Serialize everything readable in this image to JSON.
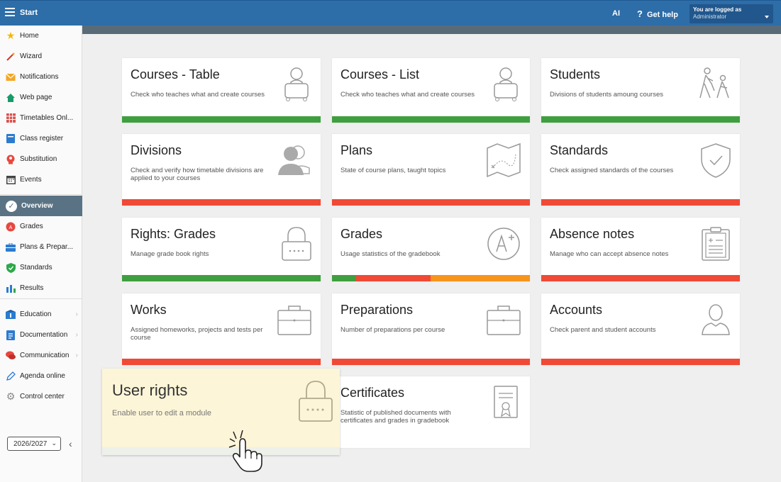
{
  "topbar": {
    "title": "Start",
    "ai_label": "AI",
    "help_label": "Get help",
    "help_icon": "?",
    "logged_line1": "You are logged as",
    "logged_line2": "Administrator"
  },
  "sidebar": {
    "items": [
      {
        "label": "Home",
        "icon": "star-icon"
      },
      {
        "label": "Wizard",
        "icon": "wand-icon"
      },
      {
        "label": "Notifications",
        "icon": "envelope-icon"
      },
      {
        "label": "Web page",
        "icon": "house-icon"
      },
      {
        "label": "Timetables Onl...",
        "icon": "timetable-icon"
      },
      {
        "label": "Class register",
        "icon": "register-icon"
      },
      {
        "label": "Substitution",
        "icon": "substitution-icon"
      },
      {
        "label": "Events",
        "icon": "calendar-icon"
      },
      {
        "label": "Overview",
        "icon": "check-circle-icon"
      },
      {
        "label": "Grades",
        "icon": "grades-icon"
      },
      {
        "label": "Plans & Prepar...",
        "icon": "briefcase-icon"
      },
      {
        "label": "Standards",
        "icon": "shield-icon"
      },
      {
        "label": "Results",
        "icon": "bar-chart-icon"
      },
      {
        "label": "Education",
        "icon": "education-icon"
      },
      {
        "label": "Documentation",
        "icon": "document-icon"
      },
      {
        "label": "Communication",
        "icon": "chat-icon"
      },
      {
        "label": "Agenda online",
        "icon": "pen-icon"
      },
      {
        "label": "Control center",
        "icon": "gear-icon"
      }
    ],
    "year": "2026/2027"
  },
  "cards": [
    {
      "title": "Courses - Table",
      "desc": "Check who teaches what and create courses"
    },
    {
      "title": "Courses - List",
      "desc": "Check who teaches what and create courses"
    },
    {
      "title": "Students",
      "desc": "Divisions of students amoung courses"
    },
    {
      "title": "Divisions",
      "desc": "Check and verify how timetable divisions are applied to your courses"
    },
    {
      "title": "Plans",
      "desc": "State of course plans, taught topics"
    },
    {
      "title": "Standards",
      "desc": "Check assigned standards of the courses"
    },
    {
      "title": "Rights: Grades",
      "desc": "Manage grade book rights"
    },
    {
      "title": "Grades",
      "desc": "Usage statistics of the gradebook"
    },
    {
      "title": "Absence notes",
      "desc": "Manage who can accept absence notes"
    },
    {
      "title": "Works",
      "desc": "Assigned homeworks, projects and tests per course"
    },
    {
      "title": "Preparations",
      "desc": "Number of preparations per course"
    },
    {
      "title": "Accounts",
      "desc": "Check parent and student accounts"
    },
    {
      "title": "Certificates",
      "desc": "Statistic of published documents with certificates and grades in gradebook"
    }
  ],
  "highlight": {
    "title": "User rights",
    "desc": "Enable user to edit a module"
  },
  "colors": {
    "accent": "#2d6da8",
    "green": "#3f9f3f",
    "red": "#f04935",
    "orange": "#f7941d",
    "highlight": "#fdf5d8"
  }
}
